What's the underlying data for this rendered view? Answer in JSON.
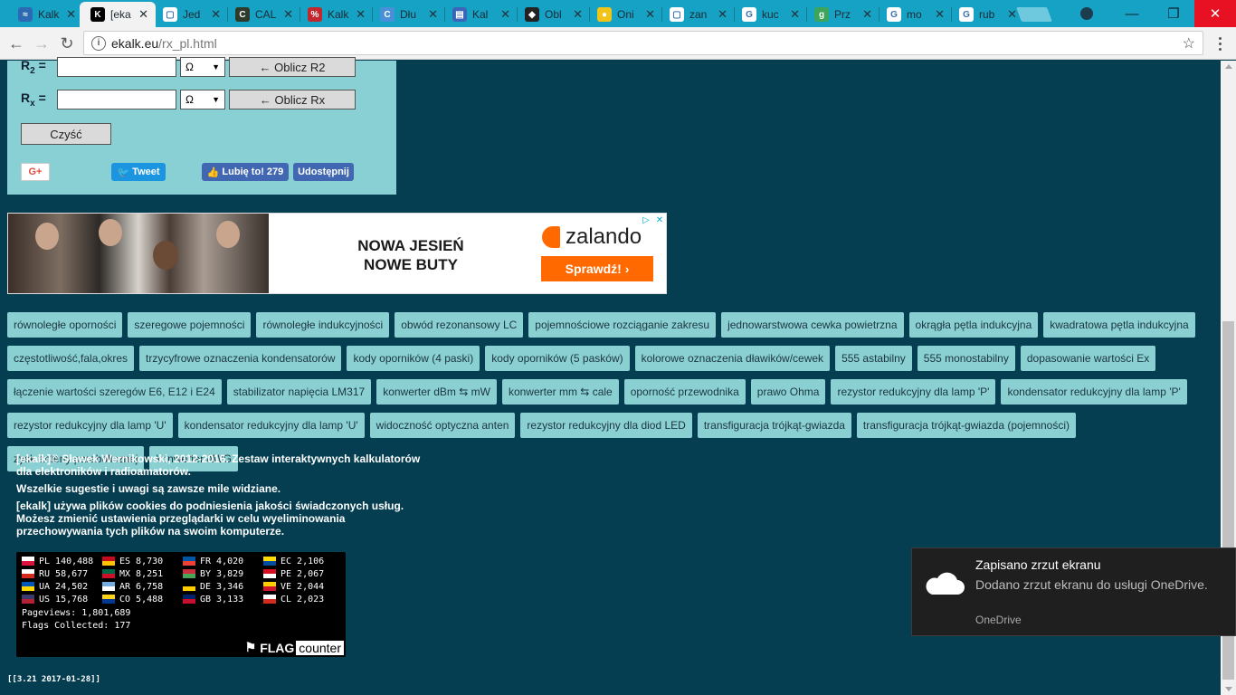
{
  "browser": {
    "tabs": [
      {
        "title": "Kalk",
        "icon_color": "#2c6bb3",
        "icon_glyph": "≈",
        "active": false
      },
      {
        "title": "[eka",
        "icon_color": "#000000",
        "icon_glyph": "K",
        "active": true
      },
      {
        "title": "Jed",
        "icon_color": "#ffffff",
        "icon_glyph": "▢",
        "active": false
      },
      {
        "title": "CAL",
        "icon_color": "#2f3b2a",
        "icon_glyph": "C",
        "active": false
      },
      {
        "title": "Kalk",
        "icon_color": "#c1272d",
        "icon_glyph": "%",
        "active": false
      },
      {
        "title": "Dłu",
        "icon_color": "#4a90d9",
        "icon_glyph": "C",
        "active": false
      },
      {
        "title": "Kal",
        "icon_color": "#3a66b8",
        "icon_glyph": "▤",
        "active": false
      },
      {
        "title": "Obl",
        "icon_color": "#222222",
        "icon_glyph": "◆",
        "active": false
      },
      {
        "title": "Oni",
        "icon_color": "#f0c419",
        "icon_glyph": "●",
        "active": false
      },
      {
        "title": "zan",
        "icon_color": "#ffffff",
        "icon_glyph": "▢",
        "active": false
      },
      {
        "title": "kuc",
        "icon_color": "#ffffff",
        "icon_glyph": "G",
        "active": false
      },
      {
        "title": "Prz",
        "icon_color": "#3ba55c",
        "icon_glyph": "g",
        "active": false
      },
      {
        "title": "mo",
        "icon_color": "#ffffff",
        "icon_glyph": "G",
        "active": false
      },
      {
        "title": "rub",
        "icon_color": "#ffffff",
        "icon_glyph": "G",
        "active": false
      }
    ],
    "tab_close_glyph": "✕",
    "window_controls": {
      "minimize": "—",
      "restore": "❐",
      "close": "✕"
    },
    "nav": {
      "back": "←",
      "forward": "→",
      "reload": "↻"
    },
    "url_host": "ekalk.eu",
    "url_path": "/rx_pl.html",
    "star": "☆",
    "info": "i"
  },
  "calc": {
    "r2": {
      "label": "R",
      "sub": "2",
      "suffix": " =",
      "value": "",
      "unit": "Ω",
      "button": "← Oblicz R2"
    },
    "rx": {
      "label": "R",
      "sub": "x",
      "suffix": " =",
      "value": "",
      "unit": "Ω",
      "button": "← Oblicz Rx"
    },
    "clear_button": "Czyść",
    "select_arrow": "▼",
    "social": {
      "gplus": "G+",
      "tweet": "Tweet",
      "like": "Lubię to! 279",
      "share": "Udostępnij"
    }
  },
  "ad": {
    "headline_line1": "NOWA JESIEŃ",
    "headline_line2": "NOWE BUTY",
    "brand": "zalando",
    "cta": "Sprawdź! ›",
    "choices": [
      "▷",
      "✕"
    ]
  },
  "links": [
    "równoległe oporności",
    "szeregowe pojemności",
    "równoległe indukcyjności",
    "obwód rezonansowy LC",
    "pojemnościowe rozciąganie zakresu",
    "jednowarstwowa cewka powietrzna",
    "okrągła pętla indukcyjna",
    "kwadratowa pętla indukcyjna",
    "częstotliwość,fala,okres",
    "trzycyfrowe oznaczenia kondensatorów",
    "kody oporników (4 paski)",
    "kody oporników (5 pasków)",
    "kolorowe oznaczenia dławików/cewek",
    "555 astabilny",
    "555 monostabilny",
    "dopasowanie wartości Ex",
    "łączenie wartości szeregów E6, E12 i E24",
    "stabilizator napięcia LM317",
    "konwerter dBm ⇆ mW",
    "konwerter mm ⇆ cale",
    "oporność przewodnika",
    "prawo Ohma",
    "rezystor redukcyjny dla lamp 'P'",
    "kondensator redukcyjny dla lamp 'P'",
    "rezystor redukcyjny dla lamp 'U'",
    "kondensator redukcyjny dla lamp 'U'",
    "widoczność optyczna anten",
    "rezystor redukcyjny dla diod LED",
    "transfiguracja trójkąt-gwiazda",
    "transfiguracja trójkąt-gwiazda (pojemności)",
    "zysk anteny parabolicznej",
    "konwerter AWG"
  ],
  "footer": {
    "copyright": "[ekalk]© Sławek Wernikowski, 2012-2016. Zestaw interaktywnych kalkulatorów dla elektroników i radioamatorów.",
    "suggestions": "Wszelkie sugestie i uwagi są zawsze mile widziane.",
    "cookies": "[ekalk] używa plików cookies do podniesienia jakości świadczonych usług. Możesz zmienić ustawienia przeglądarki w celu wyeliminowania przechowywania tych plików na swoim komputerze."
  },
  "flag_counter": {
    "countries": [
      {
        "code": "PL",
        "count": "140,488",
        "c1": "#ffffff",
        "c2": "#dc143c"
      },
      {
        "code": "ES",
        "count": "8,730",
        "c1": "#c60b1e",
        "c2": "#ffc400"
      },
      {
        "code": "FR",
        "count": "4,020",
        "c1": "#0055a4",
        "c2": "#ef4135"
      },
      {
        "code": "EC",
        "count": "2,106",
        "c1": "#ffdd00",
        "c2": "#034ea2"
      },
      {
        "code": "RU",
        "count": "58,677",
        "c1": "#ffffff",
        "c2": "#d52b1e"
      },
      {
        "code": "MX",
        "count": "8,251",
        "c1": "#006847",
        "c2": "#ce1126"
      },
      {
        "code": "BY",
        "count": "3,829",
        "c1": "#c8313e",
        "c2": "#4aa657"
      },
      {
        "code": "PE",
        "count": "2,067",
        "c1": "#d91023",
        "c2": "#ffffff"
      },
      {
        "code": "UA",
        "count": "24,502",
        "c1": "#0057b7",
        "c2": "#ffd700"
      },
      {
        "code": "AR",
        "count": "6,758",
        "c1": "#74acdf",
        "c2": "#ffffff"
      },
      {
        "code": "DE",
        "count": "3,346",
        "c1": "#000000",
        "c2": "#ffce00"
      },
      {
        "code": "VE",
        "count": "2,044",
        "c1": "#ffcc00",
        "c2": "#cf142b"
      },
      {
        "code": "US",
        "count": "15,768",
        "c1": "#3c3b6e",
        "c2": "#b22234"
      },
      {
        "code": "CO",
        "count": "5,488",
        "c1": "#fcd116",
        "c2": "#003893"
      },
      {
        "code": "GB",
        "count": "3,133",
        "c1": "#012169",
        "c2": "#c8102e"
      },
      {
        "code": "CL",
        "count": "2,023",
        "c1": "#ffffff",
        "c2": "#d52b1e"
      }
    ],
    "pageviews_label": "Pageviews:",
    "pageviews": "1,801,689",
    "flags_label": "Flags Collected:",
    "flags": "177",
    "brand_flag": "FLAG",
    "brand_counter": "counter"
  },
  "version": "[[3.21 2017-01-28]]",
  "toast": {
    "title": "Zapisano zrzut ekranu",
    "body": "Dodano zrzut ekranu do usługi OneDrive.",
    "source": "OneDrive"
  }
}
